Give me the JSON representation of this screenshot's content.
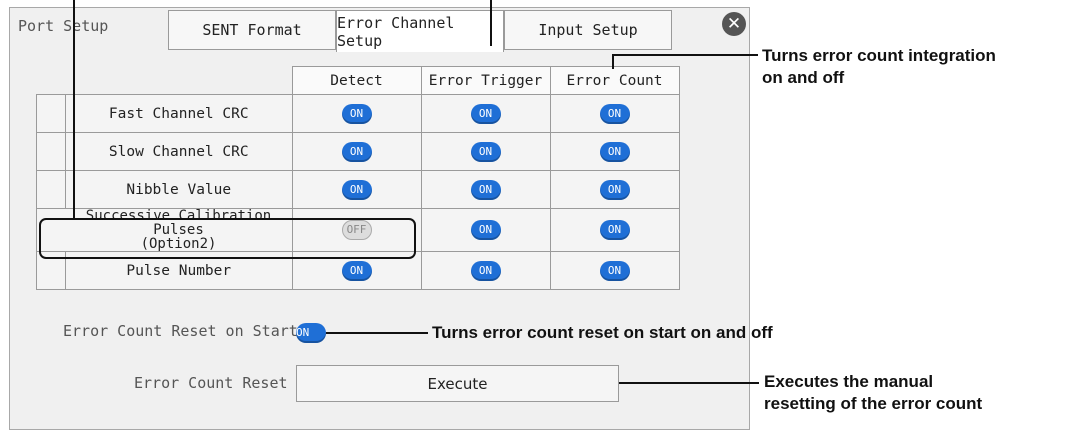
{
  "window": {
    "title": "Port Setup",
    "tabs": [
      {
        "label": "SENT Format",
        "active": false
      },
      {
        "label": "Error Channel Setup",
        "active": true
      },
      {
        "label": "Input Setup",
        "active": false
      }
    ],
    "close_icon": "close-icon"
  },
  "table": {
    "columns": [
      "Detect",
      "Error Trigger",
      "Error Count"
    ],
    "rows": [
      {
        "label": "Fast Channel CRC",
        "values": [
          "ON",
          "ON",
          "ON"
        ]
      },
      {
        "label": "Slow Channel CRC",
        "values": [
          "ON",
          "ON",
          "ON"
        ]
      },
      {
        "label": "Nibble Value",
        "values": [
          "ON",
          "ON",
          "ON"
        ]
      },
      {
        "label_line1": "Successive Calibration Pulses",
        "label_line2": "(Option2)",
        "values": [
          "OFF",
          "ON",
          "ON"
        ]
      },
      {
        "label": "Pulse Number",
        "values": [
          "ON",
          "ON",
          "ON"
        ]
      }
    ]
  },
  "settings": {
    "reset_on_start_label": "Error Count Reset on Start",
    "reset_on_start_value": "ON",
    "reset_label": "Error Count Reset",
    "execute_label": "Execute"
  },
  "callouts": {
    "error_count": [
      "Turns error count integration",
      "on and off"
    ],
    "reset_on_start": "Turns error count reset on start on and off",
    "execute": [
      "Executes the manual",
      "resetting of the error count"
    ]
  },
  "colors": {
    "on": "#1f6fd6",
    "off": "#dddddd"
  }
}
